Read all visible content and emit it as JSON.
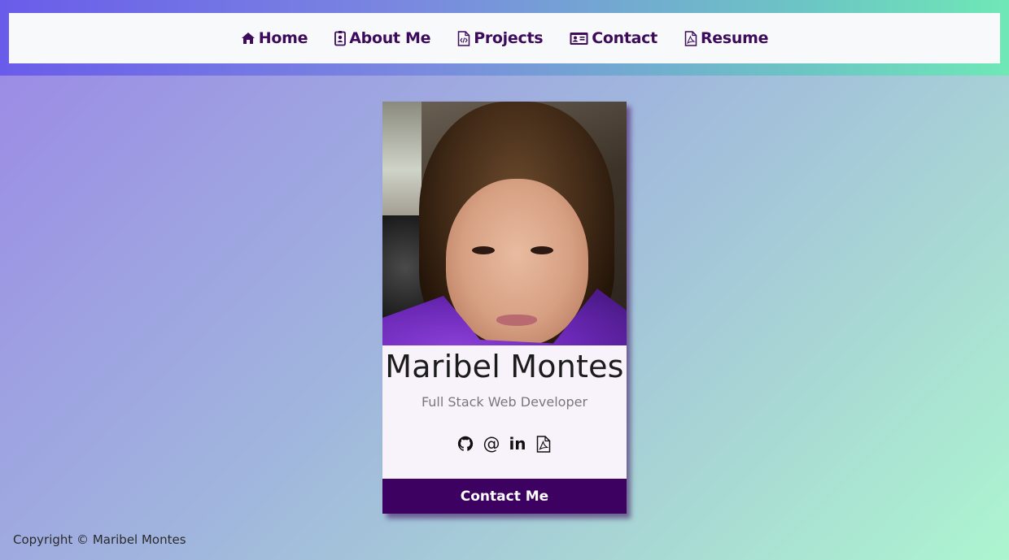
{
  "nav": {
    "items": [
      {
        "label": "Home",
        "icon": "home-icon"
      },
      {
        "label": "About Me",
        "icon": "id-badge-icon"
      },
      {
        "label": "Projects",
        "icon": "file-code-icon"
      },
      {
        "label": "Contact",
        "icon": "contact-card-icon"
      },
      {
        "label": "Resume",
        "icon": "file-pdf-icon"
      }
    ],
    "color": "#3e0b5c"
  },
  "card": {
    "photo_alt": "Maribel Montes portrait",
    "name": "Maribel Montes",
    "title": "Full Stack Web Developer",
    "social": {
      "github_icon": "github-icon",
      "email_symbol": "@",
      "linkedin_text": "in",
      "resume_icon": "file-pdf-icon"
    },
    "cta_label": "Contact Me",
    "cta_color": "#3d0161"
  },
  "footer": {
    "copyright": "Copyright © Maribel Montes"
  }
}
